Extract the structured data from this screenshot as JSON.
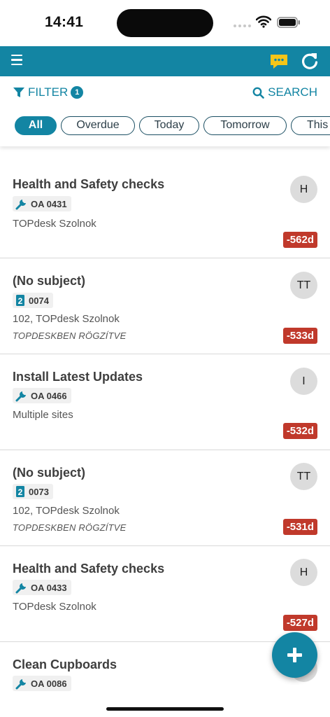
{
  "status_bar": {
    "time": "14:41"
  },
  "header": {
    "menu_icon": "hamburger-icon",
    "chat_icon": "chat-bubble-icon",
    "refresh_icon": "refresh-icon",
    "brand_color": "#1385a3"
  },
  "filter": {
    "label": "FILTER",
    "count": "1"
  },
  "search": {
    "label": "SEARCH"
  },
  "chips": [
    "All",
    "Overdue",
    "Today",
    "Tomorrow",
    "This"
  ],
  "items": [
    {
      "title": "Health and Safety checks",
      "tag_icon": "wrench-icon",
      "tag": "OA 0431",
      "location": "TOPdesk Szolnok",
      "status": "",
      "avatar": "H",
      "overdue": "-562d"
    },
    {
      "title": "(No subject)",
      "tag_icon": "number-2-icon",
      "tag": "0074",
      "location": "102, TOPdesk Szolnok",
      "status": "TOPDESKBEN RÖGZÍTVE",
      "avatar": "TT",
      "overdue": "-533d"
    },
    {
      "title": "Install Latest Updates",
      "tag_icon": "wrench-icon",
      "tag": "OA 0466",
      "location": "Multiple sites",
      "status": "",
      "avatar": "I",
      "overdue": "-532d"
    },
    {
      "title": "(No subject)",
      "tag_icon": "number-2-icon",
      "tag": "0073",
      "location": "102, TOPdesk Szolnok",
      "status": "TOPDESKBEN RÖGZÍTVE",
      "avatar": "TT",
      "overdue": "-531d"
    },
    {
      "title": "Health and Safety checks",
      "tag_icon": "wrench-icon",
      "tag": "OA 0433",
      "location": "TOPdesk Szolnok",
      "status": "",
      "avatar": "H",
      "overdue": "-527d"
    },
    {
      "title": "Clean Cupboards",
      "tag_icon": "wrench-icon",
      "tag": "OA 0086",
      "location": "",
      "status": "",
      "avatar": "",
      "overdue": ""
    }
  ],
  "fab": {
    "icon": "plus-icon"
  }
}
